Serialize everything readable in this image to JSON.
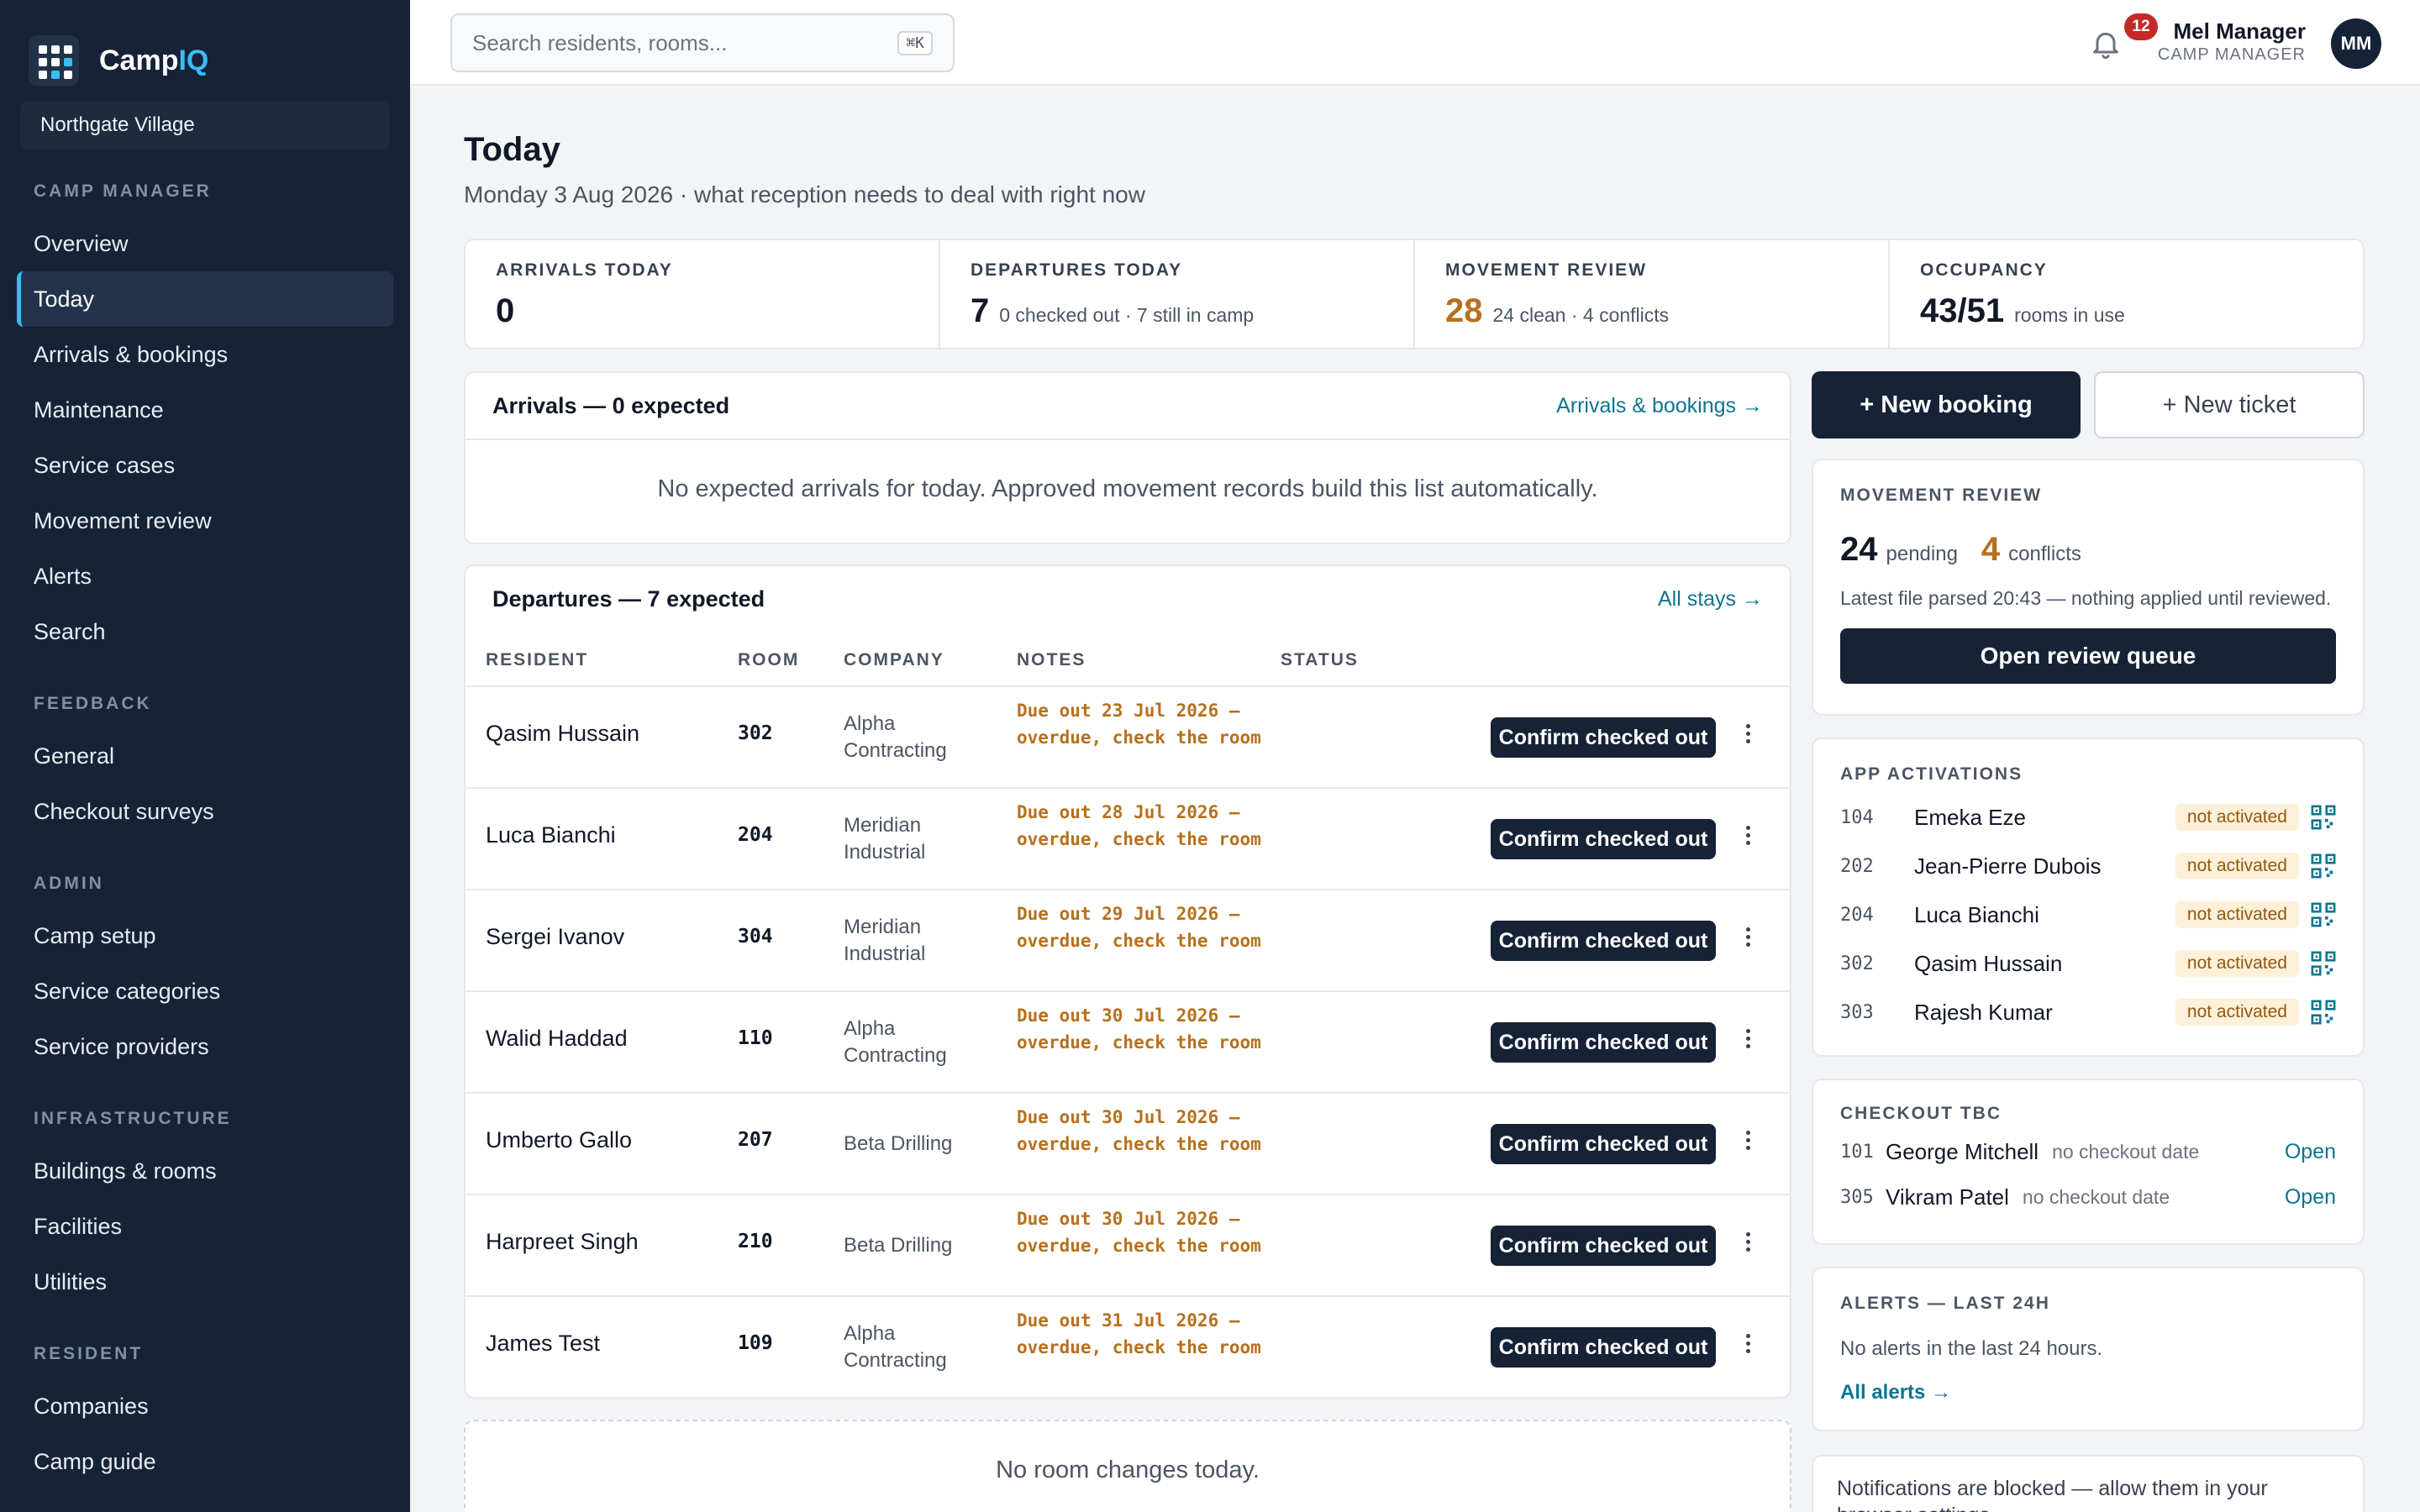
{
  "app": {
    "brand_main": "Camp",
    "brand_accent": "IQ",
    "camp": "Northgate Village"
  },
  "nav": {
    "sections": [
      {
        "title": "CAMP MANAGER",
        "items": [
          "Overview",
          "Today",
          "Arrivals & bookings",
          "Maintenance",
          "Service cases",
          "Movement review",
          "Alerts",
          "Search"
        ]
      },
      {
        "title": "FEEDBACK",
        "items": [
          "General",
          "Checkout surveys"
        ]
      },
      {
        "title": "ADMIN",
        "items": [
          "Camp setup",
          "Service categories",
          "Service providers"
        ]
      },
      {
        "title": "INFRASTRUCTURE",
        "items": [
          "Buildings & rooms",
          "Facilities",
          "Utilities"
        ]
      },
      {
        "title": "RESIDENT",
        "items": [
          "Companies",
          "Camp guide"
        ]
      }
    ],
    "active": "Today"
  },
  "topbar": {
    "search_placeholder": "Search residents, rooms...",
    "shortcut": "⌘K",
    "notif_count": "12",
    "user_name": "Mel Manager",
    "user_role": "CAMP MANAGER",
    "avatar": "MM"
  },
  "page": {
    "title": "Today",
    "subtitle": "Monday 3 Aug 2026 · what reception needs to deal with right now"
  },
  "stats": [
    {
      "label": "ARRIVALS TODAY",
      "value": "0",
      "note": ""
    },
    {
      "label": "DEPARTURES TODAY",
      "value": "7",
      "note": "0 checked out · 7 still in camp"
    },
    {
      "label": "MOVEMENT REVIEW",
      "value": "28",
      "note": "24 clean · 4 conflicts"
    },
    {
      "label": "OCCUPANCY",
      "value": "43/51",
      "note": "rooms in use"
    }
  ],
  "arrivals": {
    "title": "Arrivals — 0 expected",
    "link": "Arrivals & bookings →",
    "empty": "No expected arrivals for today. Approved movement records build this list automatically."
  },
  "departures": {
    "title": "Departures — 7 expected",
    "link": "All stays →",
    "columns": [
      "RESIDENT",
      "ROOM",
      "COMPANY",
      "NOTES",
      "STATUS"
    ],
    "action_label": "Confirm checked out",
    "rows": [
      {
        "name": "Qasim Hussain",
        "room": "302",
        "company": "Alpha Contracting",
        "notes": "Due out 23 Jul 2026 — overdue, check the room"
      },
      {
        "name": "Luca Bianchi",
        "room": "204",
        "company": "Meridian Industrial",
        "notes": "Due out 28 Jul 2026 — overdue, check the room"
      },
      {
        "name": "Sergei Ivanov",
        "room": "304",
        "company": "Meridian Industrial",
        "notes": "Due out 29 Jul 2026 — overdue, check the room"
      },
      {
        "name": "Walid Haddad",
        "room": "110",
        "company": "Alpha Contracting",
        "notes": "Due out 30 Jul 2026 — overdue, check the room"
      },
      {
        "name": "Umberto Gallo",
        "room": "207",
        "company": "Beta Drilling",
        "notes": "Due out 30 Jul 2026 — overdue, check the room"
      },
      {
        "name": "Harpreet Singh",
        "room": "210",
        "company": "Beta Drilling",
        "notes": "Due out 30 Jul 2026 — overdue, check the room"
      },
      {
        "name": "James Test",
        "room": "109",
        "company": "Alpha Contracting",
        "notes": "Due out 31 Jul 2026 — overdue, check the room"
      }
    ]
  },
  "room_changes": {
    "empty": "No room changes today."
  },
  "actions": {
    "new_booking": "+ New booking",
    "new_ticket": "+ New ticket"
  },
  "movement_review": {
    "title": "MOVEMENT REVIEW",
    "pending": "24",
    "pending_label": "pending",
    "conflicts": "4",
    "conflicts_label": "conflicts",
    "note": "Latest file parsed 20:43 — nothing applied until reviewed.",
    "button": "Open review queue"
  },
  "app_activations": {
    "title": "APP ACTIVATIONS",
    "status_label": "not activated",
    "rows": [
      {
        "room": "104",
        "name": "Emeka Eze"
      },
      {
        "room": "202",
        "name": "Jean-Pierre Dubois"
      },
      {
        "room": "204",
        "name": "Luca Bianchi"
      },
      {
        "room": "302",
        "name": "Qasim Hussain"
      },
      {
        "room": "303",
        "name": "Rajesh Kumar"
      }
    ]
  },
  "checkout_tbc": {
    "title": "CHECKOUT TBC",
    "note": "no checkout date",
    "open_label": "Open",
    "rows": [
      {
        "room": "101",
        "name": "George Mitchell"
      },
      {
        "room": "305",
        "name": "Vikram Patel"
      }
    ]
  },
  "alerts": {
    "title": "ALERTS — LAST 24H",
    "empty": "No alerts in the last 24 hours.",
    "link": "All alerts →"
  },
  "notice": {
    "text": "Notifications are blocked — allow them in your browser settings."
  },
  "colors": {
    "sidebar": "#162236",
    "accent": "#38bdf8",
    "amber": "#b7701c",
    "link": "#0e7490"
  }
}
